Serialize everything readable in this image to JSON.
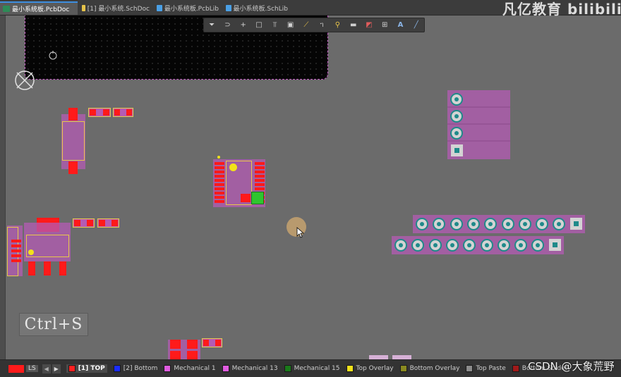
{
  "tabs": [
    {
      "label": "最小系统板.PcbDoc",
      "icon_color": "#e6c34a",
      "active": true
    },
    {
      "label": "[1] 最小系统.SchDoc",
      "icon_color": "#e6c34a",
      "active": false
    },
    {
      "label": "最小系统板.PcbLib",
      "icon_color": "#e6c34a",
      "active": false
    },
    {
      "label": "最小系统板.SchLib",
      "icon_color": "#e6c34a",
      "active": false
    }
  ],
  "brand_text": "凡亿教育 bilibili",
  "toolbar_icons": [
    "filter-icon",
    "route-icon",
    "plus-icon",
    "select-rect-icon",
    "align-icon",
    "component-icon",
    "interactive-route-icon",
    "diff-pair-icon",
    "via-icon",
    "fill-icon",
    "keepout-icon",
    "dimension-icon",
    "text-icon",
    "line-icon"
  ],
  "toolbar_glyphs": [
    "⏷",
    "⊃",
    "+",
    "□",
    "⫪",
    "▣",
    "⟋",
    "ᥐ",
    "⚲",
    "▬",
    "◩",
    "⊞",
    "A",
    "╱"
  ],
  "canvas": {
    "shortcut_label": "Ctrl+S"
  },
  "layer_bar": {
    "current_color": "#ff1a1a",
    "ls_label": "LS",
    "layers": [
      {
        "name": "[1] TOP",
        "color": "#ff2020",
        "active": true
      },
      {
        "name": "[2] Bottom",
        "color": "#1a2cff",
        "active": false
      },
      {
        "name": "Mechanical 1",
        "color": "#e05ce0",
        "active": false
      },
      {
        "name": "Mechanical 13",
        "color": "#e05ce0",
        "active": false
      },
      {
        "name": "Mechanical 15",
        "color": "#1a7a1a",
        "active": false
      },
      {
        "name": "Top Overlay",
        "color": "#f2e21a",
        "active": false
      },
      {
        "name": "Bottom Overlay",
        "color": "#8a8a20",
        "active": false
      },
      {
        "name": "Top Paste",
        "color": "#8c8c8c",
        "active": false
      },
      {
        "name": "Bottom Solder",
        "color": "#a01a1a",
        "active": false
      }
    ]
  },
  "watermark": "CSDN @大象荒野"
}
